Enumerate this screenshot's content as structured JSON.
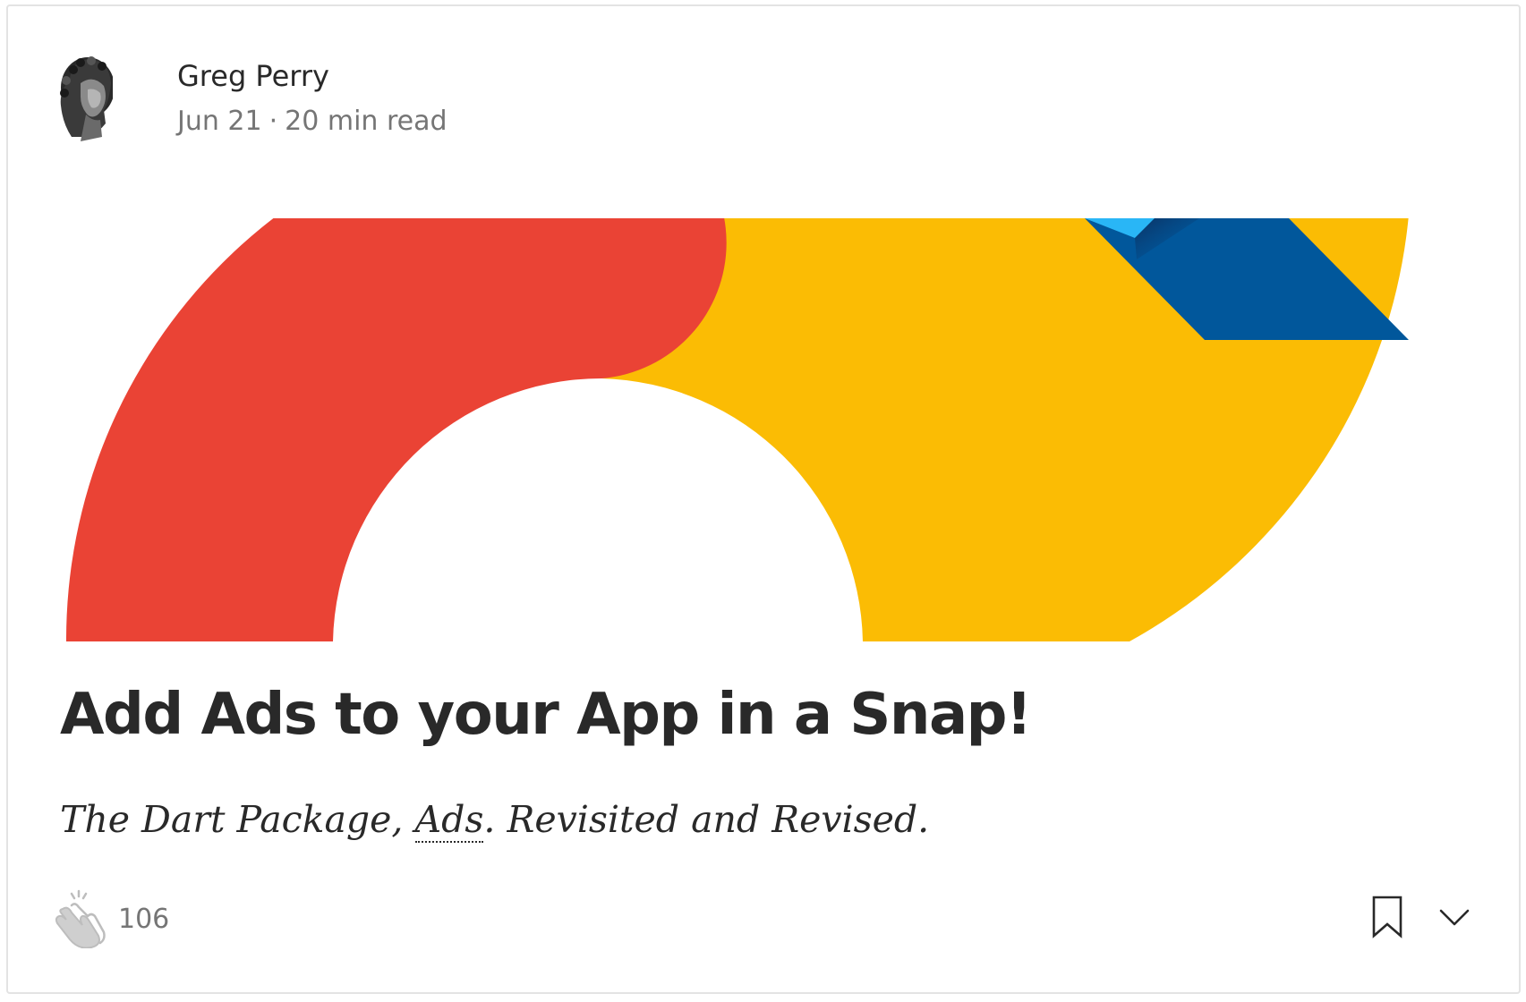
{
  "author": {
    "name": "Greg Perry",
    "date": "Jun 21",
    "separator": "·",
    "read_time": "20 min read"
  },
  "article": {
    "title": "Add Ads to your App in a Snap!",
    "subtitle_before": "The Dart Package,",
    "subtitle_abbr": "Ads",
    "subtitle_after": ". Revisited and Revised."
  },
  "footer": {
    "clap_count": "106"
  },
  "colors": {
    "red": "#EA4335",
    "yellow": "#FBBC04",
    "light_blue": "#29B6F6",
    "dark_blue": "#01579B"
  },
  "icons": {
    "clap": "clap-icon",
    "bookmark": "bookmark-icon",
    "more": "chevron-down-icon"
  }
}
